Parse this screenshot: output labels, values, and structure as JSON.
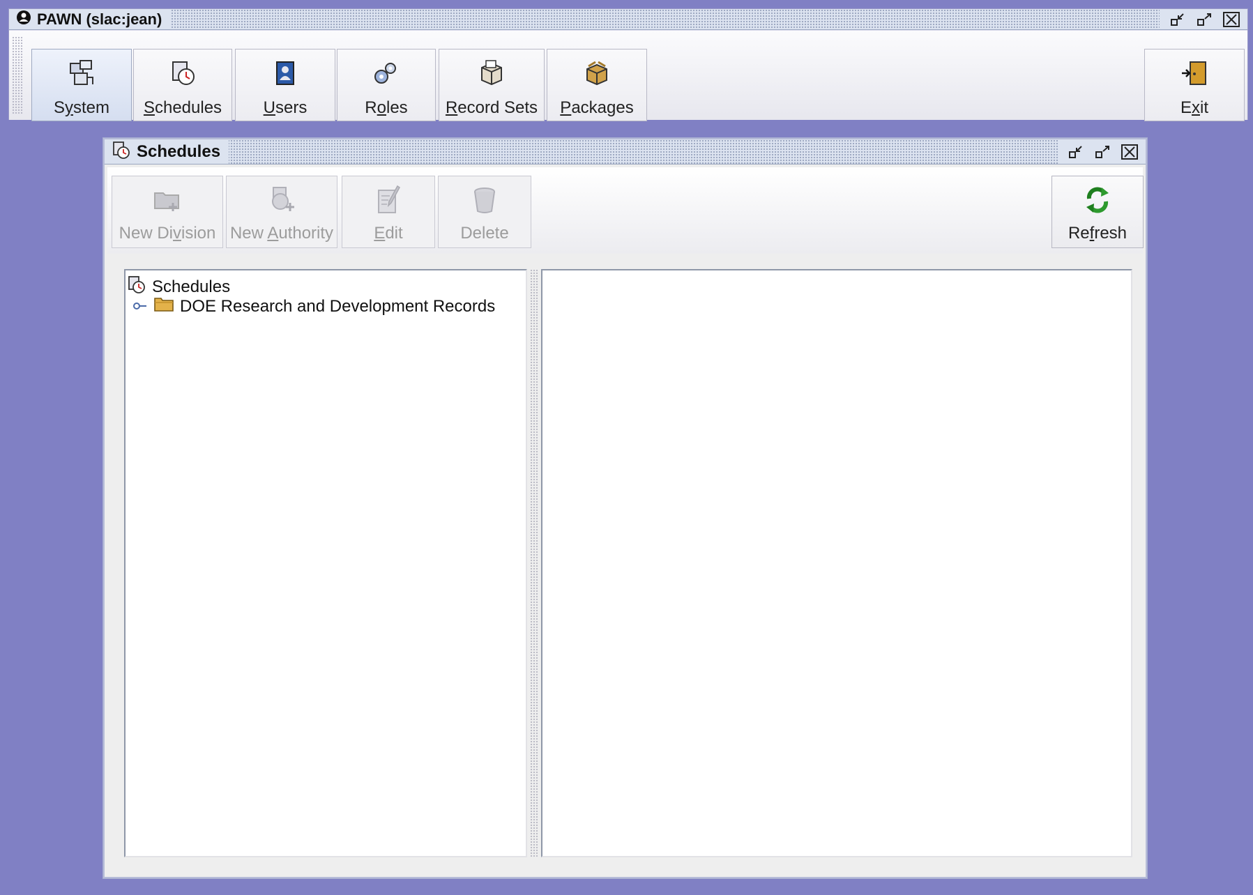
{
  "app": {
    "title": "PAWN (slac:jean)",
    "toolbar": [
      {
        "label": "System",
        "underline": "y",
        "icon": "system-icon",
        "selected": true
      },
      {
        "label": "Schedules",
        "underline": "S",
        "icon": "schedules-icon",
        "selected": false
      },
      {
        "label": "Users",
        "underline": "U",
        "icon": "users-icon",
        "selected": false
      },
      {
        "label": "Roles",
        "underline": "o",
        "icon": "roles-icon",
        "selected": false
      },
      {
        "label": "Record Sets",
        "underline": "R",
        "icon": "record-sets-icon",
        "selected": false
      },
      {
        "label": "Packages",
        "underline": "P",
        "icon": "packages-icon",
        "selected": false
      }
    ],
    "exit_label": "Exit"
  },
  "schedules_window": {
    "title": "Schedules",
    "toolbar": [
      {
        "label": "New Division",
        "underline": "v",
        "icon": "new-division-icon",
        "enabled": false
      },
      {
        "label": "New Authority",
        "underline": "A",
        "icon": "new-authority-icon",
        "enabled": false
      },
      {
        "label": "Edit",
        "underline": "E",
        "icon": "edit-icon",
        "enabled": false
      },
      {
        "label": "Delete",
        "underline": "",
        "icon": "delete-icon",
        "enabled": false
      }
    ],
    "refresh_label": "Refresh",
    "tree": {
      "root": "Schedules",
      "children": [
        "DOE Research and Development Records"
      ]
    }
  },
  "colors": {
    "desktop": "#8080c4",
    "refresh_green": "#2e9a2e"
  }
}
